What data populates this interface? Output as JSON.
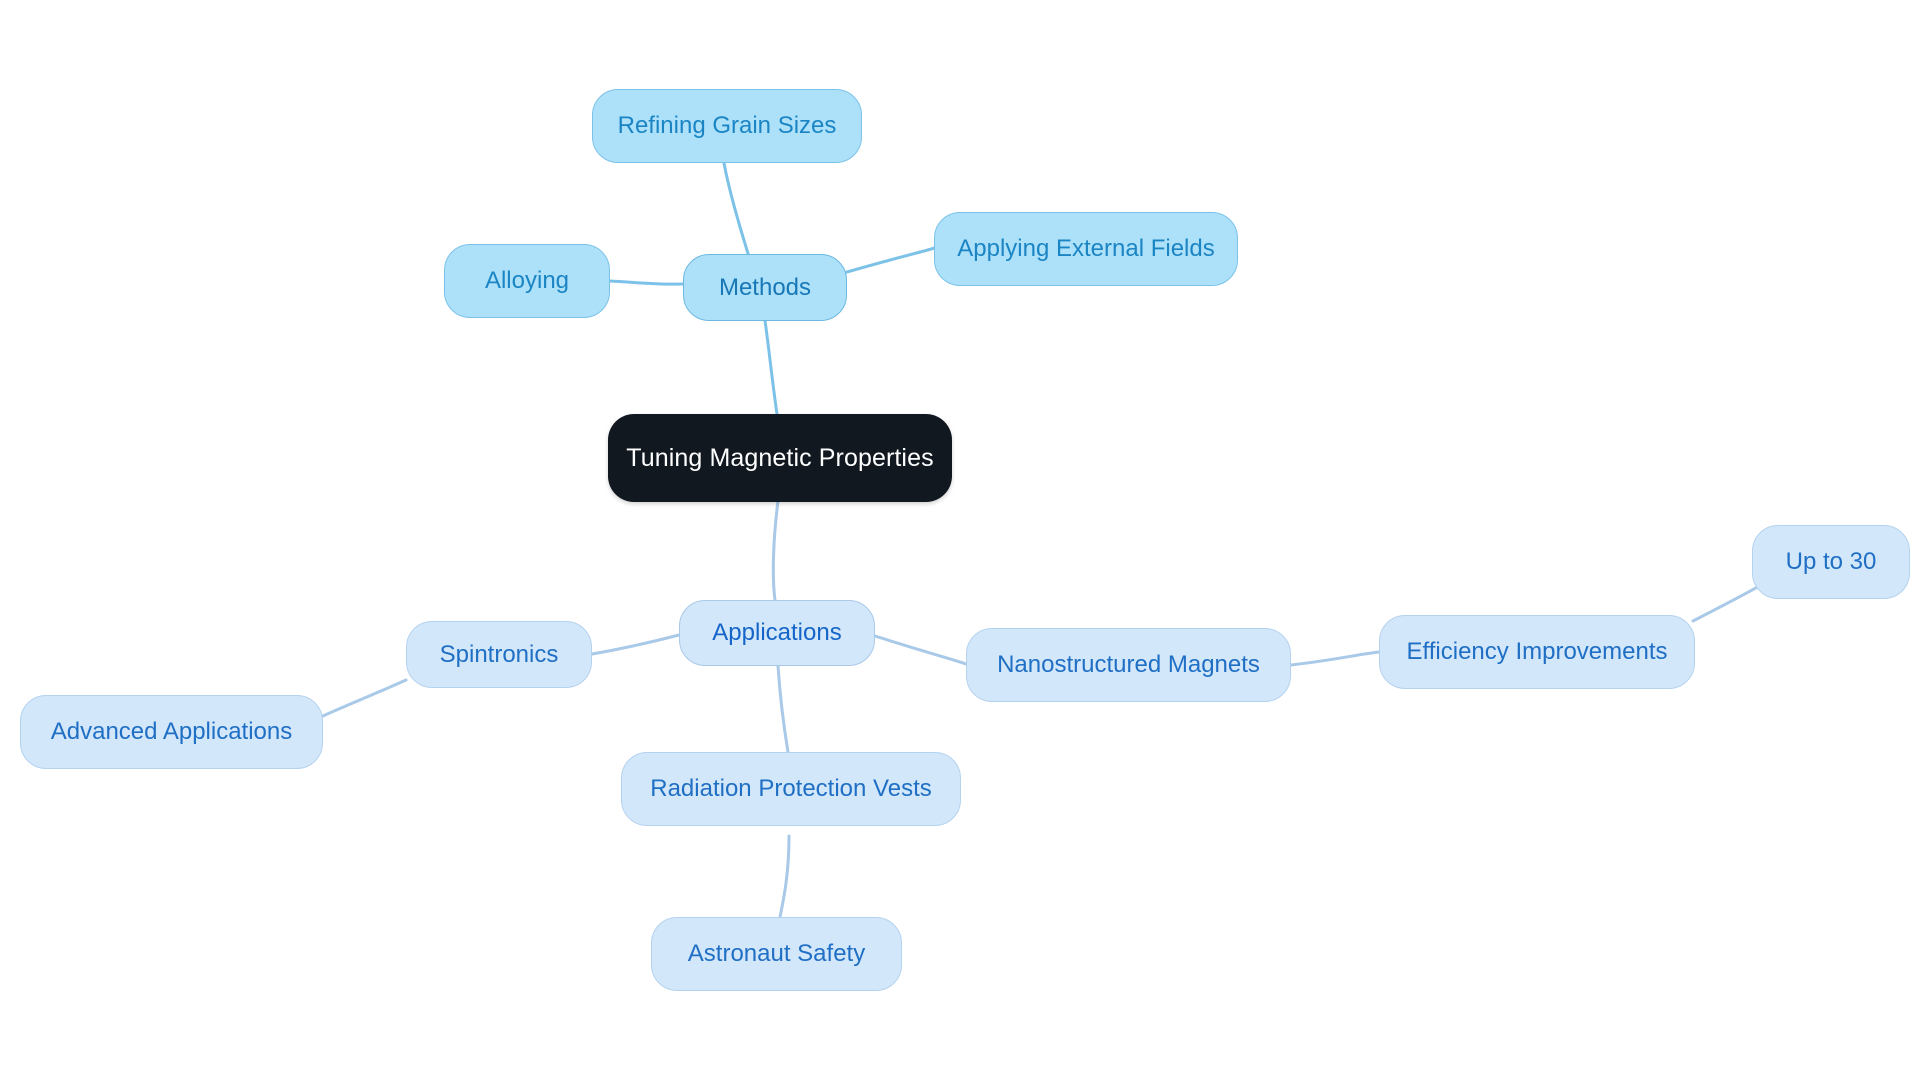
{
  "diagram": {
    "type": "mindmap",
    "title": "Tuning Magnetic Properties",
    "background_color": "#ffffff",
    "palette": {
      "root_fill": "#111820",
      "root_text": "#ffffff",
      "branch_a_fill": "#ade1fa",
      "branch_a_stroke": "#6cb8e0",
      "branch_a_text": "#1877b5",
      "branch_b_fill": "#d3e7fb",
      "branch_b_stroke": "#a9c9e8",
      "branch_b_text": "#1565c9",
      "edge_upper": "#7cc2e8",
      "edge_lower": "#a9c9e8"
    }
  },
  "nodes": {
    "root": {
      "label": "Tuning Magnetic Properties"
    },
    "methods": {
      "label": "Methods"
    },
    "refining_grain_sizes": {
      "label": "Refining Grain Sizes"
    },
    "alloying": {
      "label": "Alloying"
    },
    "applying_external_fields": {
      "label": "Applying External Fields"
    },
    "applications": {
      "label": "Applications"
    },
    "spintronics": {
      "label": "Spintronics"
    },
    "advanced_applications": {
      "label": "Advanced Applications"
    },
    "nanostructured_magnets": {
      "label": "Nanostructured Magnets"
    },
    "efficiency_improvements": {
      "label": "Efficiency Improvements"
    },
    "up_to_30": {
      "label": "Up to 30"
    },
    "radiation_protection_vests": {
      "label": "Radiation Protection Vests"
    },
    "astronaut_safety": {
      "label": "Astronaut Safety"
    }
  },
  "edges": [
    {
      "from": "root",
      "to": "methods"
    },
    {
      "from": "methods",
      "to": "refining_grain_sizes"
    },
    {
      "from": "methods",
      "to": "alloying"
    },
    {
      "from": "methods",
      "to": "applying_external_fields"
    },
    {
      "from": "root",
      "to": "applications"
    },
    {
      "from": "applications",
      "to": "spintronics"
    },
    {
      "from": "spintronics",
      "to": "advanced_applications"
    },
    {
      "from": "applications",
      "to": "nanostructured_magnets"
    },
    {
      "from": "nanostructured_magnets",
      "to": "efficiency_improvements"
    },
    {
      "from": "efficiency_improvements",
      "to": "up_to_30"
    },
    {
      "from": "applications",
      "to": "radiation_protection_vests"
    },
    {
      "from": "radiation_protection_vests",
      "to": "astronaut_safety"
    }
  ]
}
